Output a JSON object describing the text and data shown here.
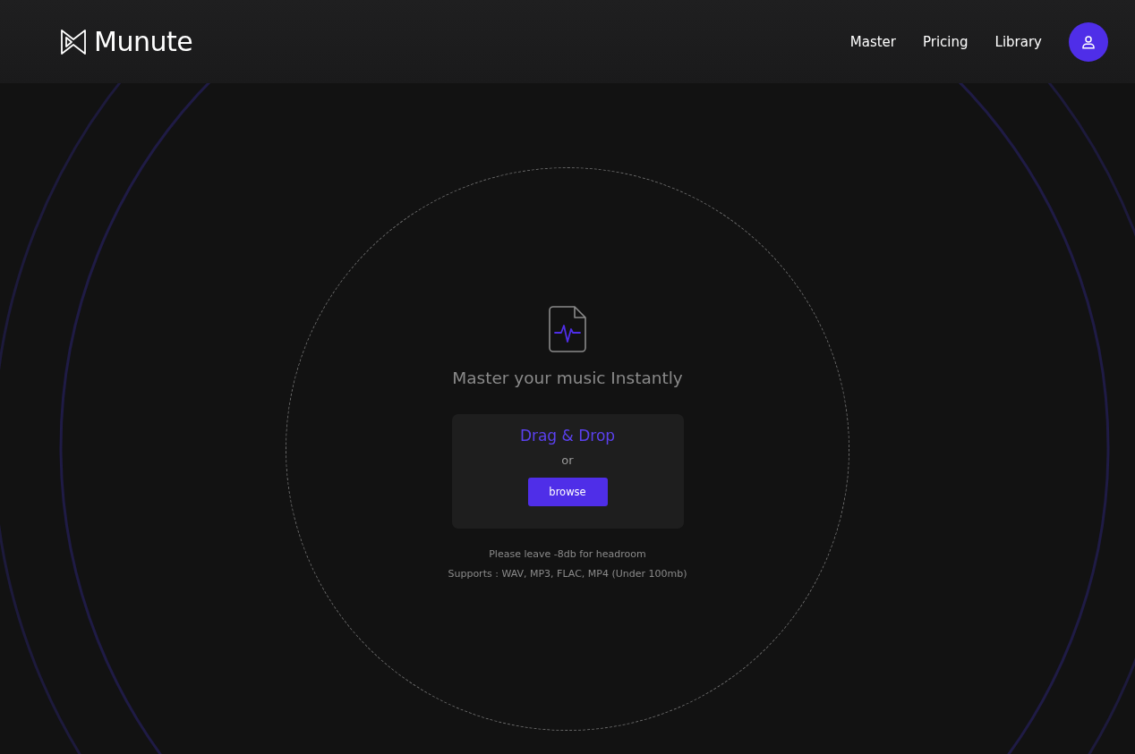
{
  "header": {
    "brand": "Munute",
    "nav": [
      {
        "label": "Master"
      },
      {
        "label": "Pricing"
      },
      {
        "label": "Library"
      }
    ]
  },
  "upload": {
    "heading": "Master your music Instantly",
    "drop_label": "Drag & Drop",
    "separator": "or",
    "button": "browse",
    "notes": [
      "Please leave -8db for headroom",
      "Supports : WAV, MP3, FLAC, MP4 (Under 100mb)"
    ]
  }
}
